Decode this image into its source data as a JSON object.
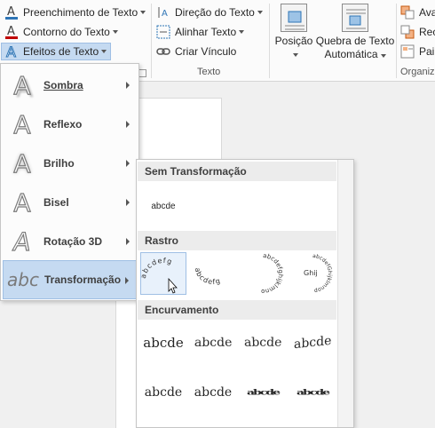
{
  "ribbon": {
    "fill_text": "Preenchimento de Texto",
    "outline_text": "Contorno do Texto",
    "effects_text": "Efeitos de Texto",
    "direction_text": "Direção do Texto",
    "align_text": "Alinhar Texto",
    "link_text": "Criar Vínculo",
    "group_text": "Texto",
    "position": "Posição",
    "wrap_line1": "Quebra de Texto",
    "wrap_line2": "Automática",
    "advance": "Ava",
    "recortar": "Recc",
    "pair": "Pair",
    "group_organize": "Organiz",
    "accent_colors": {
      "fill": "#2e75b6",
      "outline": "#c00000",
      "effects": "#2e75b6"
    }
  },
  "effects_menu": {
    "items": [
      {
        "glyph": "A",
        "label": "Sombra",
        "accel": "S",
        "icon": "shadow-icon"
      },
      {
        "glyph": "A",
        "label": "Reflexo",
        "accel": "x",
        "icon": "reflection-icon"
      },
      {
        "glyph": "A",
        "label": "Brilho",
        "accel": "l",
        "icon": "glow-icon"
      },
      {
        "glyph": "A",
        "label": "Bisel",
        "accel": "i",
        "icon": "bevel-icon"
      },
      {
        "glyph": "A",
        "label": "Rotação 3D",
        "accel": "D",
        "icon": "rotation-3d-icon"
      },
      {
        "glyph": "abc",
        "label": "Transformação",
        "accel": "T",
        "icon": "transform-icon"
      }
    ]
  },
  "gallery": {
    "headers": {
      "none": "Sem Transformação",
      "path": "Rastro",
      "warp": "Encurvamento"
    },
    "none_sample": "abcde",
    "path_samples": [
      "abcdefg",
      "abcdefg",
      "abcdefghijklmno",
      "abcdefGhijklmnop"
    ],
    "warp_row1": [
      "abcde",
      "abcde",
      "abcde",
      "abcde"
    ],
    "warp_row2": [
      "abcde",
      "abcde",
      "abcde",
      "abcde"
    ]
  }
}
